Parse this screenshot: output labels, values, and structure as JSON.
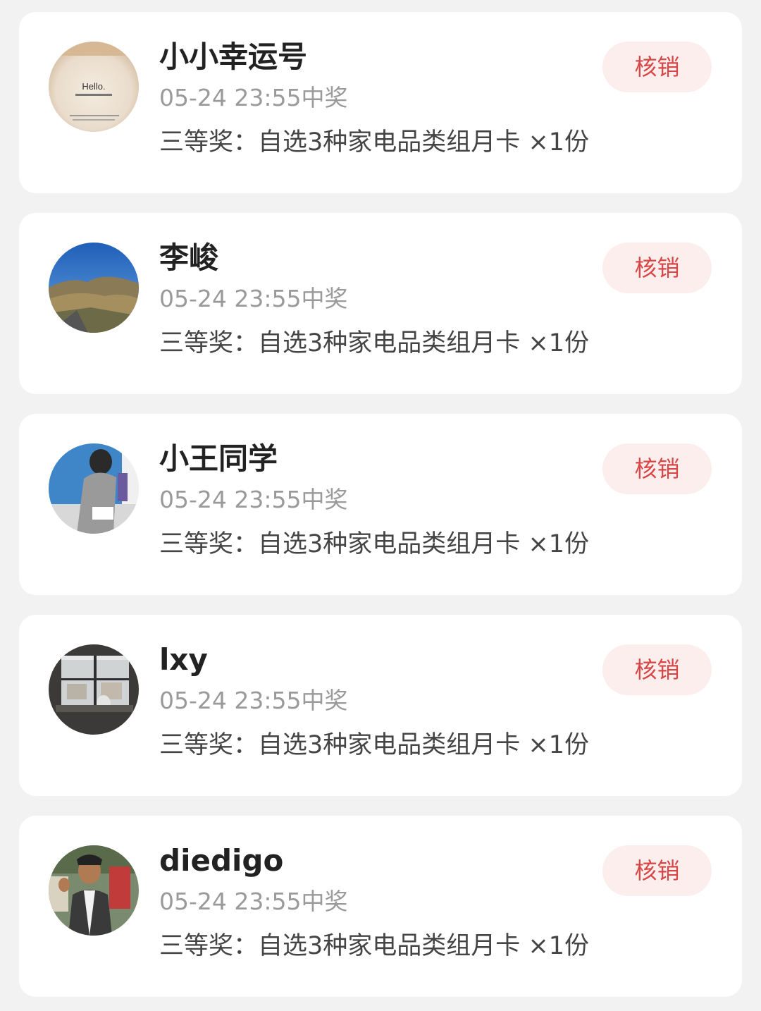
{
  "accent_color": "#d84545",
  "button_bg": "#fdeeee",
  "winners": [
    {
      "name": "小小幸运号",
      "time": "05-24 23:55中奖",
      "prize": "三等奖：自选3种家电品类组月卡 ×1份",
      "action": "核销",
      "avatar": {
        "icon": "avatar-paper-note",
        "text": "Hello."
      }
    },
    {
      "name": "李峻",
      "time": "05-24 23:55中奖",
      "prize": "三等奖：自选3种家电品类组月卡 ×1份",
      "action": "核销",
      "avatar": {
        "icon": "avatar-landscape"
      }
    },
    {
      "name": "小王同学",
      "time": "05-24 23:55中奖",
      "prize": "三等奖：自选3种家电品类组月卡 ×1份",
      "action": "核销",
      "avatar": {
        "icon": "avatar-illustration"
      }
    },
    {
      "name": "lxy",
      "time": "05-24 23:55中奖",
      "prize": "三等奖：自选3种家电品类组月卡 ×1份",
      "action": "核销",
      "avatar": {
        "icon": "avatar-window-cat"
      }
    },
    {
      "name": "diedigo",
      "time": "05-24 23:55中奖",
      "prize": "三等奖：自选3种家电品类组月卡 ×1份",
      "action": "核销",
      "avatar": {
        "icon": "avatar-person-photo"
      }
    }
  ]
}
